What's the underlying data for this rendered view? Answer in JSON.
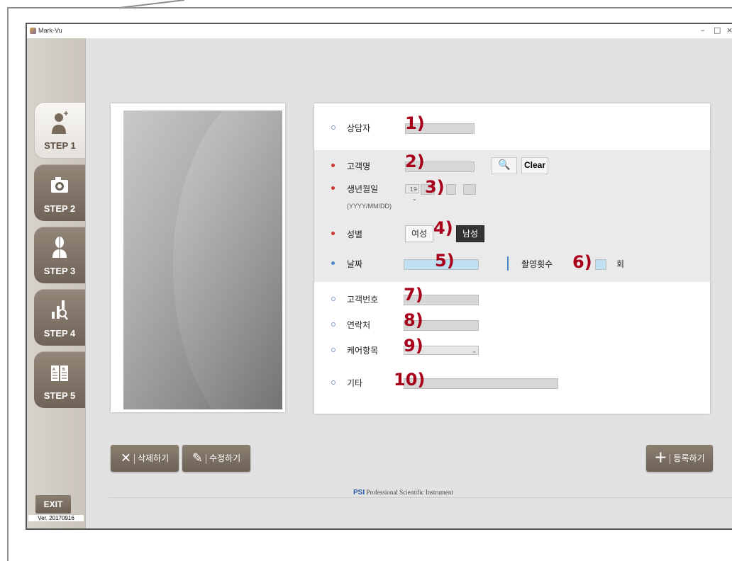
{
  "window": {
    "title": "Mark-Vu",
    "minimize": "–",
    "maximize": "□",
    "close": "×"
  },
  "sidebar": {
    "steps": [
      {
        "label": "STEP 1",
        "icon": "user-add-icon",
        "active": true
      },
      {
        "label": "STEP 2",
        "icon": "camera-icon",
        "active": false
      },
      {
        "label": "STEP 3",
        "icon": "face-analysis-icon",
        "active": false
      },
      {
        "label": "STEP 4",
        "icon": "chart-search-icon",
        "active": false
      },
      {
        "label": "STEP 5",
        "icon": "compare-book-icon",
        "active": false
      }
    ],
    "exit_label": "EXIT",
    "version": "Ver. 20170916"
  },
  "form": {
    "counselor_label": "상담자",
    "customer_name_label": "고객명",
    "search_icon": "🔍",
    "clear_label": "Clear",
    "birth_label": "생년월일",
    "birth_year_prefix": "19",
    "birth_format": "(YYYY/MM/DD)",
    "gender_label": "성별",
    "female_label": "여성",
    "male_label": "남성",
    "date_label": "날짜",
    "shots_label": "촬영횟수",
    "shots_unit": "회",
    "customer_no_label": "고객번호",
    "contact_label": "연락처",
    "care_item_label": "케어항목",
    "etc_label": "기타"
  },
  "callouts": [
    "1)",
    "2)",
    "3)",
    "4)",
    "5)",
    "6)",
    "7)",
    "8)",
    "9)",
    "10)"
  ],
  "actions": {
    "delete_label": "삭제하기",
    "edit_label": "수정하기",
    "register_label": "등록하기"
  },
  "footer": {
    "brand_mark": "PSI",
    "brand_text": "Professional Scientific Instrument"
  },
  "colors": {
    "accent_brown": "#7d7063",
    "callout_red": "#a8001b",
    "required_dot": "#cc3333",
    "info_dot": "#4a88c8"
  }
}
